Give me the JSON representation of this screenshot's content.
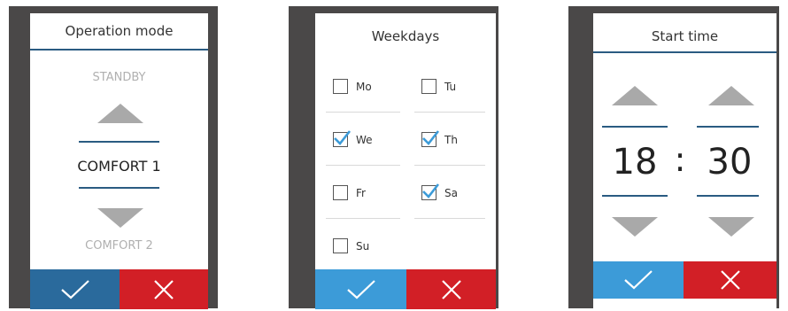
{
  "panels": {
    "operation_mode": {
      "title": "Operation mode",
      "prev_option": "STANDBY",
      "current_option": "COMFORT 1",
      "next_option": "COMFORT 2",
      "confirm_color": "#2a6a9c",
      "cancel_color": "#d21f26"
    },
    "weekdays": {
      "title": "Weekdays",
      "days": [
        {
          "label": "Mo",
          "checked": false
        },
        {
          "label": "Tu",
          "checked": false
        },
        {
          "label": "We",
          "checked": true
        },
        {
          "label": "Th",
          "checked": true
        },
        {
          "label": "Fr",
          "checked": false
        },
        {
          "label": "Sa",
          "checked": true
        },
        {
          "label": "Su",
          "checked": false
        }
      ],
      "confirm_color": "#3c9bd8",
      "cancel_color": "#d21f26",
      "check_color": "#3c9bd8"
    },
    "start_time": {
      "title": "Start time",
      "hours": "18",
      "separator": ":",
      "minutes": "30",
      "confirm_color": "#3c9bd8",
      "cancel_color": "#d21f26"
    }
  }
}
